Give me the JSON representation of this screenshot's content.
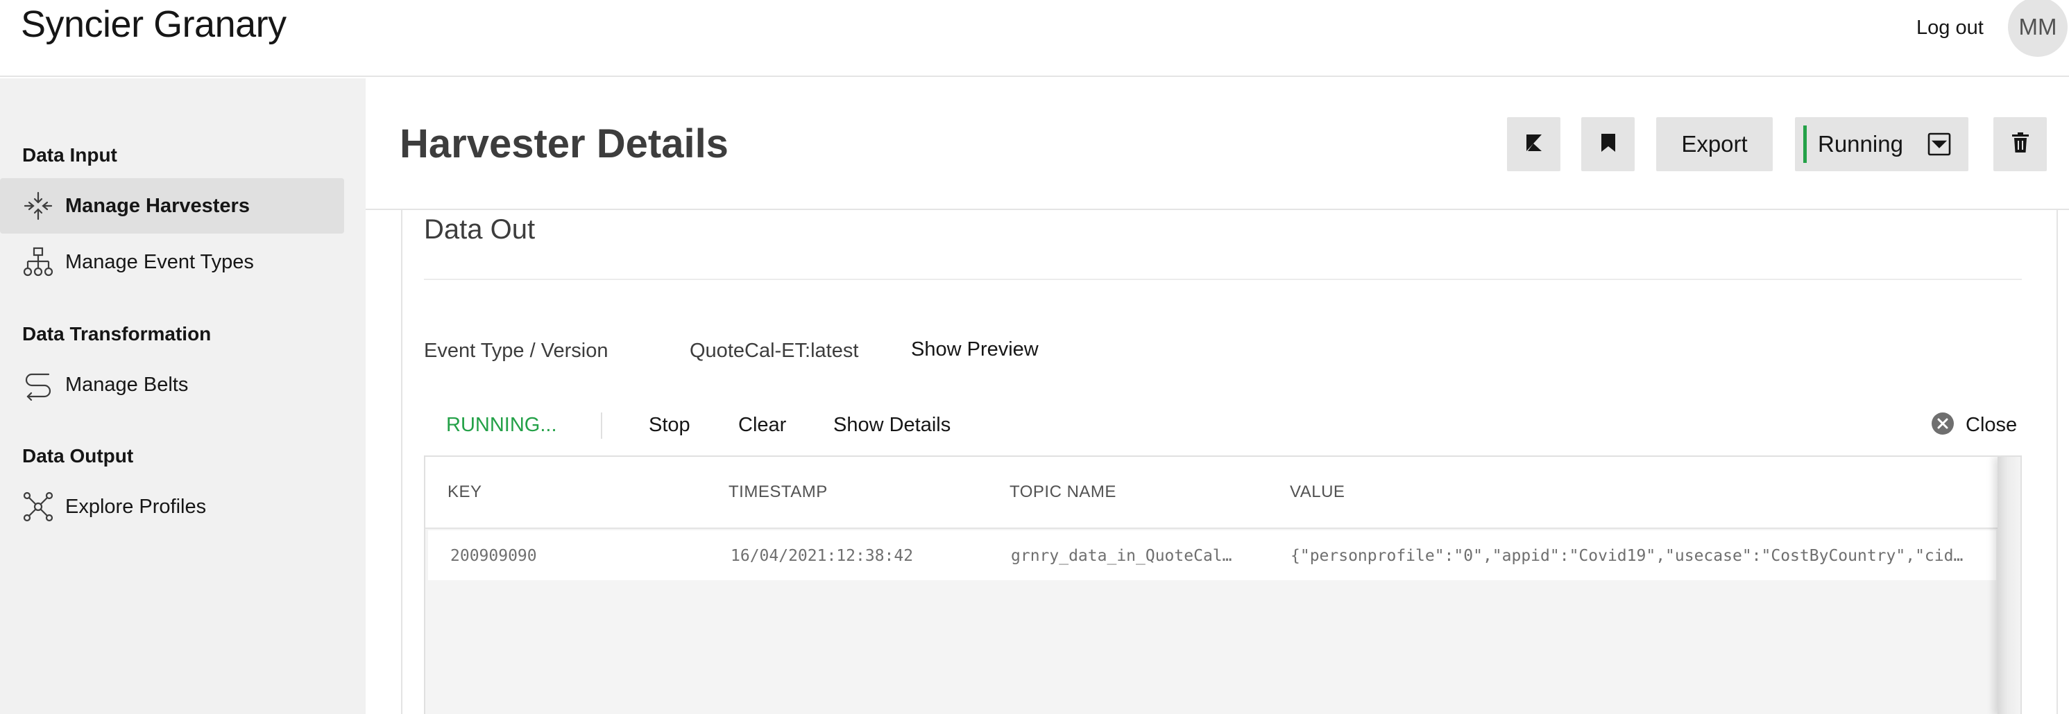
{
  "app": {
    "title": "Syncier Granary",
    "logout_label": "Log out",
    "avatar_initials": "MM"
  },
  "sidebar": {
    "groups": [
      {
        "label": "Data Input",
        "items": [
          {
            "label": "Manage Harvesters",
            "icon": "harvester-icon",
            "active": true
          },
          {
            "label": "Manage Event Types",
            "icon": "hierarchy-icon",
            "active": false
          }
        ]
      },
      {
        "label": "Data Transformation",
        "items": [
          {
            "label": "Manage Belts",
            "icon": "belt-route-icon",
            "active": false
          }
        ]
      },
      {
        "label": "Data Output",
        "items": [
          {
            "label": "Explore Profiles",
            "icon": "network-nodes-icon",
            "active": false
          }
        ]
      }
    ]
  },
  "header": {
    "title": "Harvester Details",
    "export_label": "Export",
    "status_label": "Running",
    "status_color": "#24a148",
    "icon_buttons": [
      "kibana-icon",
      "bookmark-icon",
      "trash-icon"
    ]
  },
  "data_out": {
    "title": "Data Out",
    "event_type_label": "Event Type / Version",
    "event_type_value": "QuoteCal-ET:latest",
    "show_preview_label": "Show Preview",
    "toolbar": {
      "status": "RUNNING...",
      "stop_label": "Stop",
      "clear_label": "Clear",
      "show_details_label": "Show Details",
      "close_label": "Close"
    },
    "table": {
      "columns": [
        "KEY",
        "TIMESTAMP",
        "TOPIC NAME",
        "VALUE"
      ],
      "rows": [
        {
          "key": "200909090",
          "timestamp": "16/04/2021:12:38:42",
          "topic": "grnry_data_in_QuoteCal…",
          "value": "{\"personprofile\":\"0\",\"appid\":\"Covid19\",\"usecase\":\"CostByCountry\",\"cid…"
        }
      ]
    }
  }
}
